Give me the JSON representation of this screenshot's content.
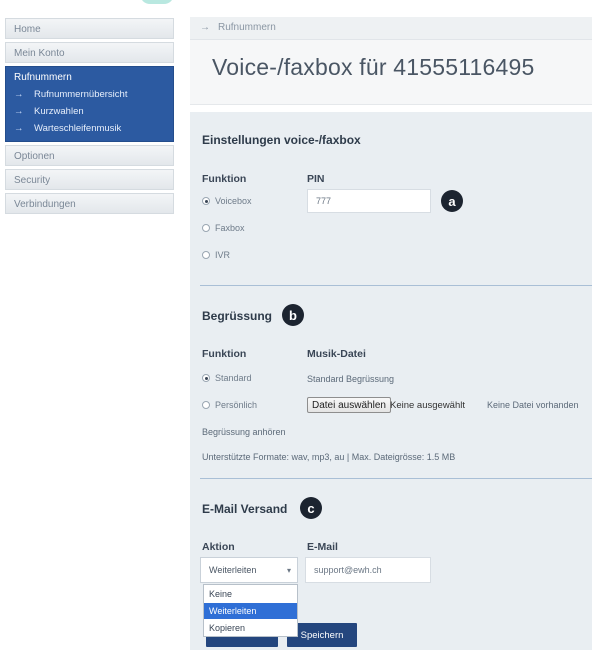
{
  "sidebar": {
    "items_top": [
      "Home",
      "Mein Konto"
    ],
    "group": {
      "title": "Rufnummern",
      "subitems": [
        "Rufnummernübersicht",
        "Kurzwahlen",
        "Warteschleifenmusik"
      ]
    },
    "items_bottom": [
      "Optionen",
      "Security",
      "Verbindungen"
    ],
    "arrow": "→"
  },
  "breadcrumb": {
    "arrow": "→",
    "label": "Rufnummern"
  },
  "page_title": "Voice-/faxbox für 41555116495",
  "settings": {
    "title": "Einstellungen voice-/faxbox",
    "funktion_label": "Funktion",
    "pin_label": "PIN",
    "pin_value": "777",
    "options": [
      {
        "label": "Voicebox",
        "selected": true
      },
      {
        "label": "Faxbox",
        "selected": false
      },
      {
        "label": "IVR",
        "selected": false
      }
    ],
    "badge": "a"
  },
  "greeting": {
    "title": "Begrüssung",
    "badge": "b",
    "funktion_label": "Funktion",
    "music_label": "Musik-Datei",
    "options": [
      {
        "label": "Standard",
        "selected": true
      },
      {
        "label": "Persönlich",
        "selected": false
      }
    ],
    "standard_text": "Standard Begrüssung",
    "file_button": "Datei auswählen",
    "file_none": "Keine ausgewählt",
    "no_file": "Keine Datei vorhanden",
    "listen_link": "Begrüssung anhören",
    "formats_text": "Unterstützte Formate: wav, mp3, au | Max. Dateigrösse: 1.5 MB"
  },
  "email": {
    "title": "E-Mail Versand",
    "badge": "c",
    "aktion_label": "Aktion",
    "email_label": "E-Mail",
    "select_value": "Weiterleiten",
    "email_value": "support@ewh.ch",
    "dropdown_options": [
      {
        "label": "Keine",
        "selected": false
      },
      {
        "label": "Weiterleiten",
        "selected": true
      },
      {
        "label": "Kopieren",
        "selected": false
      }
    ]
  },
  "buttons": {
    "save": "Speichern"
  },
  "colors": {
    "accent": "#2c5aa1",
    "button": "#24467e",
    "dropdown_highlight": "#2f6fd6"
  }
}
